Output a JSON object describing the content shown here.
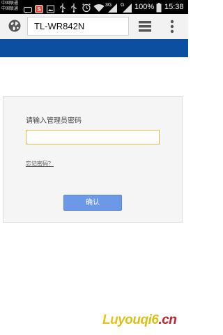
{
  "status_bar": {
    "carrier_line1": "中国联通",
    "carrier_line2": "中国联通",
    "network_3g": "3G",
    "network_g": "G",
    "battery": "100%",
    "time": "15:38",
    "icons": [
      "message-icon",
      "app-s-icon",
      "usb-icon",
      "usb-icon",
      "alarm-icon",
      "wifi-icon",
      "signal-icon",
      "signal-icon",
      "battery-icon"
    ]
  },
  "browser": {
    "url": "TL-WR842N",
    "icons": [
      "globe-icon",
      "tabs-icon",
      "menu-icon"
    ]
  },
  "login": {
    "prompt": "请输入管理员密码",
    "password_value": "",
    "forgot_link": "忘记密码？",
    "confirm_label": "确认"
  },
  "watermark": {
    "text_lu": "Lu",
    "text_mid": "youqi6",
    "text_tld": ".cn"
  },
  "colors": {
    "brand_bar": "#0c4fa0",
    "button": "#6c98e8",
    "input_border": "#e6b74a"
  }
}
